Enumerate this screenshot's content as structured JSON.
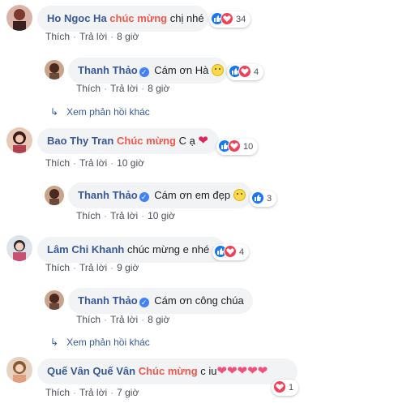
{
  "colors": {
    "name": "#385898",
    "highlight": "#f0584d",
    "like": "#1877f2",
    "love": "#f33e58"
  },
  "action_labels": {
    "like": "Thích",
    "reply": "Trả lời"
  },
  "more_replies": "Xem phản hồi khác",
  "comments": [
    {
      "name": "Ho Ngoc Ha",
      "highlight": "chúc mừng",
      "text": " chị nhé",
      "time": "8 giờ",
      "reactions": "34"
    },
    {
      "name": "Thanh Thảo",
      "text": "Cám ơn Hà",
      "emoji": "smiley",
      "time": "8 giờ",
      "reactions": "4"
    },
    {
      "name": "Bao Thy Tran",
      "highlight": "Chúc mừng",
      "text": " C ạ",
      "emoji": "heart",
      "time": "10 giờ",
      "reactions": "10"
    },
    {
      "name": "Thanh Thảo",
      "text": "Cám ơn em đẹp",
      "emoji": "smiley",
      "time": "10 giờ",
      "reactions": "3"
    },
    {
      "name": "Lâm Chi Khanh",
      "text": "chúc mừng e nhé",
      "time": "9 giờ",
      "reactions": "4"
    },
    {
      "name": "Thanh Thảo",
      "text": "Cám ơn công chúa",
      "time": "8 giờ"
    },
    {
      "name": "Quế Vân Quế Vân",
      "highlight": "Chúc mừng",
      "text": " c iu",
      "emoji": "hearts",
      "time": "7 giờ",
      "reactions": "1"
    }
  ]
}
